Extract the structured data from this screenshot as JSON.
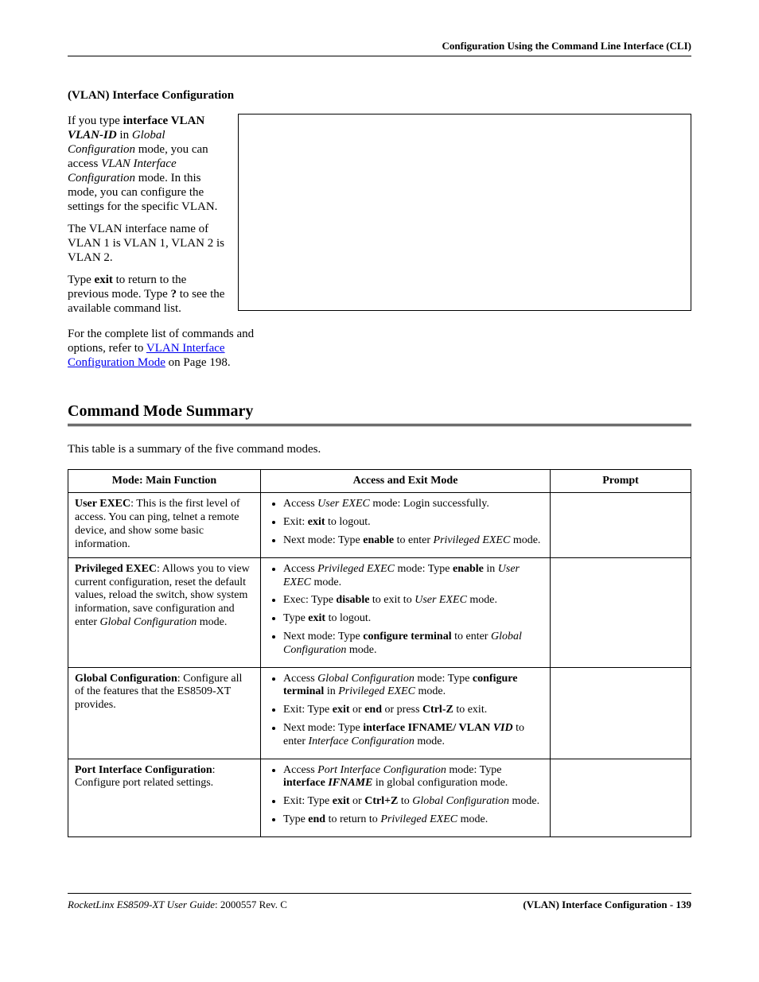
{
  "header": "Configuration Using the Command Line Interface (CLI)",
  "sectionTitle": "(VLAN) Interface Configuration",
  "paras": {
    "p1a": "If you type ",
    "p1b": "interface VLAN ",
    "p1c": "VLAN-ID",
    "p1d": " in ",
    "p1e": "Global Configuration",
    "p1f": " mode, you can access ",
    "p1g": "VLAN Interface Configuration",
    "p1h": " mode. In this mode, you can configure the settings for the specific VLAN.",
    "p2": "The VLAN interface name of VLAN 1 is VLAN 1, VLAN 2 is VLAN 2.",
    "p3a": "Type ",
    "p3b": "exit",
    "p3c": " to return to the previous mode. Type ",
    "p3d": "?",
    "p3e": " to see the available command list.",
    "p4a": "For the complete list of commands and options, refer to ",
    "p4link": "VLAN Interface Configuration Mode",
    "p4b": " on Page 198."
  },
  "h2": "Command Mode Summary",
  "intro": "This table is a summary of the five command modes.",
  "table": {
    "headers": [
      "Mode: Main Function",
      "Access and Exit Mode",
      "Prompt"
    ],
    "rows": [
      {
        "mode_bold": "User EXEC",
        "mode_rest": ": This is the first level of access. You can ping, telnet a remote device, and show some basic information.",
        "bullets": [
          {
            "pre": "Access ",
            "em1": "User EXEC",
            "mid1": " mode: Login successfully."
          },
          {
            "pre": "Exit: ",
            "b1": "exit",
            "mid1": " to logout."
          },
          {
            "pre": "Next mode: Type ",
            "b1": "enable",
            "mid1": " to enter ",
            "em1": "Privileged EXEC",
            "post": " mode."
          }
        ]
      },
      {
        "mode_bold": "Privileged EXEC",
        "mode_rest_a": ": Allows you to view current configuration, reset the default values, reload the switch, show system information, save configuration and enter ",
        "mode_rest_em": "Global Configuration",
        "mode_rest_b": " mode.",
        "bullets": [
          {
            "pre": "Access ",
            "em1": "Privileged EXEC",
            "mid1": " mode: Type ",
            "b1": "enable",
            "mid2": " in ",
            "em2": "User EXEC",
            "post": " mode."
          },
          {
            "pre": "Exec: Type ",
            "b1": "disable",
            "mid1": " to exit to ",
            "em1": "User EXEC",
            "post": " mode."
          },
          {
            "pre": "Type ",
            "b1": "exit",
            "mid1": " to logout."
          },
          {
            "pre": "Next mode: Type ",
            "b1": "configure terminal",
            "mid1": " to enter ",
            "em1": "Global Configuration",
            "post": " mode."
          }
        ]
      },
      {
        "mode_bold": "Global Configuration",
        "mode_rest": ": Configure all of the features that the ES8509-XT provides.",
        "bullets": [
          {
            "pre": "Access ",
            "em1": "Global Configuration",
            "mid1": " mode: Type ",
            "b1": "configure terminal",
            "mid2": " in ",
            "em2": "Privileged EXEC",
            "post": " mode."
          },
          {
            "pre": "Exit: Type ",
            "b1": "exit",
            "mid1": " or ",
            "b2": "end",
            "mid2": " or press ",
            "b3": "Ctrl-Z",
            "post": " to exit."
          },
          {
            "pre": "Next mode: Type ",
            "b1": "interface IFNAME/ VLAN ",
            "em1": "VID",
            "mid1": " to enter ",
            "em2": "Interface Configuration",
            "post": " mode."
          }
        ]
      },
      {
        "mode_bold": "Port Interface Configuration",
        "mode_rest": ": Configure port related settings.",
        "bullets": [
          {
            "pre": "Access ",
            "em1": "Port Interface Configuration",
            "mid1": " mode: Type ",
            "b1": "interface ",
            "bem1": "IFNAME",
            "post": " in global configuration mode."
          },
          {
            "pre": "Exit: Type ",
            "b1": "exit",
            "mid1": " or ",
            "b2": "Ctrl+Z",
            "mid2": " to ",
            "em1": "Global Configuration",
            "post": " mode."
          },
          {
            "pre": "Type ",
            "b1": "end",
            "mid1": " to return to ",
            "em1": "Privileged EXEC",
            "post": " mode."
          }
        ]
      }
    ]
  },
  "footer": {
    "leftItalic": "RocketLinx ES8509-XT User Guide",
    "leftRest": ": 2000557 Rev. C",
    "right": "(VLAN) Interface Configuration - 139"
  }
}
